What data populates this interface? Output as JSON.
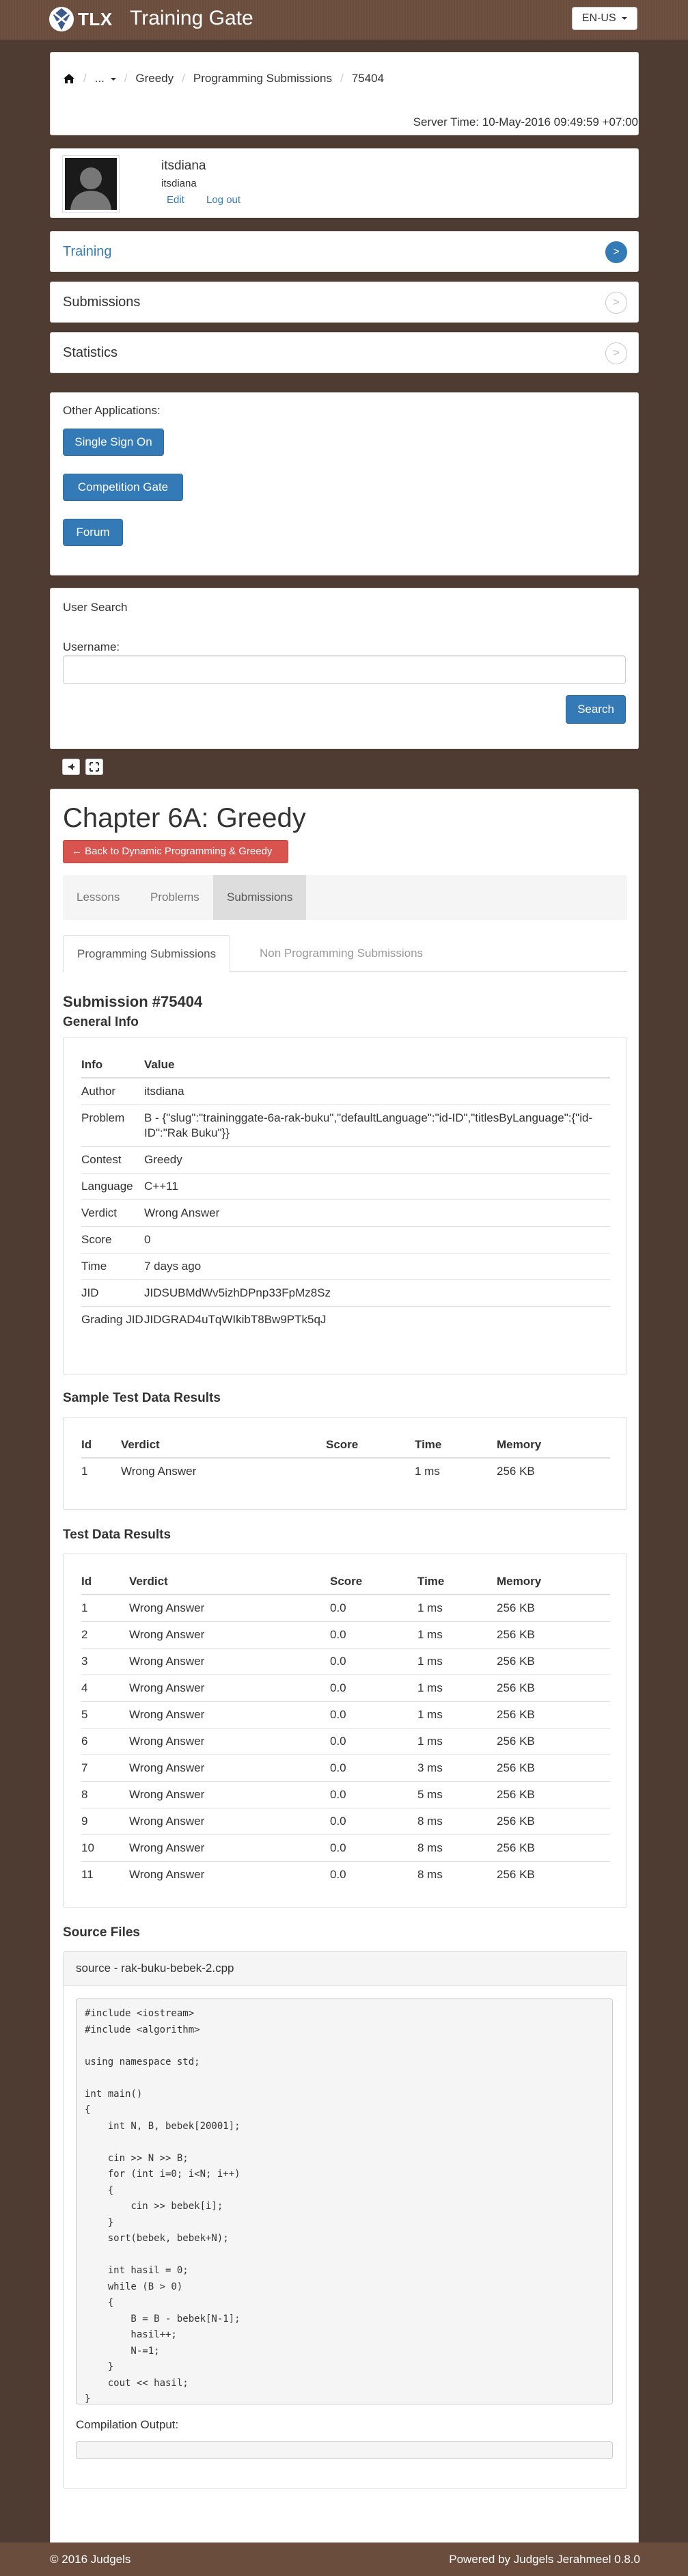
{
  "header": {
    "logo_text": "TLX",
    "app_name": "Training Gate",
    "language": "EN-US"
  },
  "breadcrumb": {
    "ellipsis": "...",
    "items": [
      "Greedy",
      "Programming Submissions",
      "75404"
    ]
  },
  "server_time": "Server Time: 10-May-2016 09:49:59 +07:00",
  "user": {
    "name": "itsdiana",
    "username": "itsdiana",
    "edit_label": "Edit",
    "logout_label": "Log out"
  },
  "sidebar_menu": [
    {
      "label": "Training",
      "arrow": ">",
      "active": true
    },
    {
      "label": "Submissions",
      "arrow": ">",
      "active": false
    },
    {
      "label": "Statistics",
      "arrow": ">",
      "active": false
    }
  ],
  "other_apps": {
    "title": "Other Applications:",
    "buttons": [
      "Single Sign On",
      "Competition Gate",
      "Forum"
    ]
  },
  "user_search": {
    "title": "User Search",
    "username_label": "Username:",
    "username_value": "",
    "search_label": "Search"
  },
  "chapter": {
    "title": "Chapter 6A: Greedy",
    "back_label": "Back to Dynamic Programming & Greedy",
    "tabs": [
      "Lessons",
      "Problems",
      "Submissions"
    ],
    "active_tab": "Submissions",
    "subtabs": [
      "Programming Submissions",
      "Non Programming Submissions"
    ],
    "active_subtab": "Programming Submissions"
  },
  "submission": {
    "title": "Submission #75404",
    "general_info_title": "General Info",
    "info_headers": [
      "Info",
      "Value"
    ],
    "info_rows": [
      {
        "key": "Author",
        "value": "itsdiana"
      },
      {
        "key": "Problem",
        "value": "B - {\"slug\":\"traininggate-6a-rak-buku\",\"defaultLanguage\":\"id-ID\",\"titlesByLanguage\":{\"id-ID\":\"Rak Buku\"}}"
      },
      {
        "key": "Contest",
        "value": "Greedy"
      },
      {
        "key": "Language",
        "value": "C++11"
      },
      {
        "key": "Verdict",
        "value": "Wrong Answer"
      },
      {
        "key": "Score",
        "value": "0"
      },
      {
        "key": "Time",
        "value": "7 days ago"
      },
      {
        "key": "JID",
        "value": "JIDSUBMdWv5izhDPnp33FpMz8Sz"
      },
      {
        "key": "Grading JID",
        "value": "JIDGRAD4uTqWIkibT8Bw9PTk5qJ"
      }
    ],
    "sample_title": "Sample Test Data Results",
    "sample_headers": [
      "Id",
      "Verdict",
      "Score",
      "Time",
      "Memory"
    ],
    "sample_rows": [
      {
        "id": "1",
        "verdict": "Wrong Answer",
        "score": "",
        "time": "1 ms",
        "memory": "256 KB"
      }
    ],
    "test_title": "Test Data Results",
    "test_headers": [
      "Id",
      "Verdict",
      "Score",
      "Time",
      "Memory"
    ],
    "test_rows": [
      {
        "id": "1",
        "verdict": "Wrong Answer",
        "score": "0.0",
        "time": "1 ms",
        "memory": "256 KB"
      },
      {
        "id": "2",
        "verdict": "Wrong Answer",
        "score": "0.0",
        "time": "1 ms",
        "memory": "256 KB"
      },
      {
        "id": "3",
        "verdict": "Wrong Answer",
        "score": "0.0",
        "time": "1 ms",
        "memory": "256 KB"
      },
      {
        "id": "4",
        "verdict": "Wrong Answer",
        "score": "0.0",
        "time": "1 ms",
        "memory": "256 KB"
      },
      {
        "id": "5",
        "verdict": "Wrong Answer",
        "score": "0.0",
        "time": "1 ms",
        "memory": "256 KB"
      },
      {
        "id": "6",
        "verdict": "Wrong Answer",
        "score": "0.0",
        "time": "1 ms",
        "memory": "256 KB"
      },
      {
        "id": "7",
        "verdict": "Wrong Answer",
        "score": "0.0",
        "time": "3 ms",
        "memory": "256 KB"
      },
      {
        "id": "8",
        "verdict": "Wrong Answer",
        "score": "0.0",
        "time": "5 ms",
        "memory": "256 KB"
      },
      {
        "id": "9",
        "verdict": "Wrong Answer",
        "score": "0.0",
        "time": "8 ms",
        "memory": "256 KB"
      },
      {
        "id": "10",
        "verdict": "Wrong Answer",
        "score": "0.0",
        "time": "8 ms",
        "memory": "256 KB"
      },
      {
        "id": "11",
        "verdict": "Wrong Answer",
        "score": "0.0",
        "time": "8 ms",
        "memory": "256 KB"
      }
    ],
    "source_title": "Source Files",
    "source_file_label": "source - rak-buku-bebek-2.cpp",
    "source_code": "#include <iostream>\n#include <algorithm>\n\nusing namespace std;\n\nint main()\n{\n    int N, B, bebek[20001];\n\n    cin >> N >> B;\n    for (int i=0; i<N; i++)\n    {\n        cin >> bebek[i];\n    }\n    sort(bebek, bebek+N);\n\n    int hasil = 0;\n    while (B > 0)\n    {\n        B = B - bebek[N-1];\n        hasil++;\n        N-=1;\n    }\n    cout << hasil;\n}",
    "compilation_label": "Compilation Output:",
    "compilation_output": ""
  },
  "footer": {
    "copyright": "© 2016 Judgels",
    "powered_by": "Powered by Judgels Jerahmeel 0.8.0"
  },
  "colors": {
    "brand_brown": "#6b4d3e",
    "primary_blue": "#337ab7",
    "danger_red": "#d9534f"
  }
}
